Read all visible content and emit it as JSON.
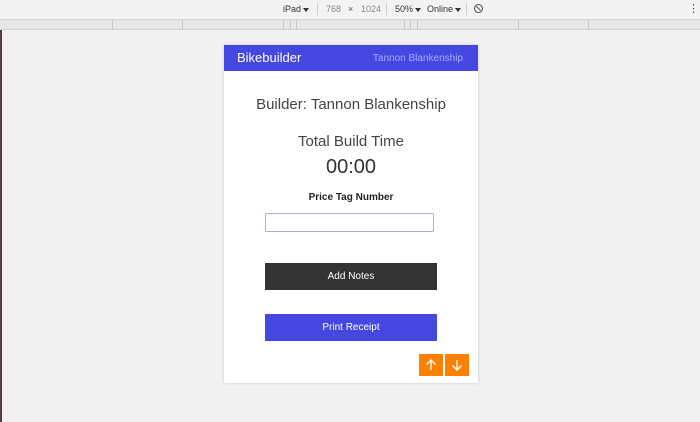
{
  "devtools": {
    "device": "iPad",
    "width": "768",
    "times": "×",
    "height": "1024",
    "zoom": "50%",
    "network": "Online",
    "rotate_icon": "rotate-icon",
    "more_icon": "more-vertical-icon"
  },
  "app": {
    "brand": "Bikebuilder",
    "header_user": "Tannon Blankenship",
    "colors": {
      "primary": "#4448e0",
      "dark": "#333333",
      "orange": "#ff7f00"
    }
  },
  "content": {
    "builder_line": "Builder: Tannon Blankenship",
    "total_label": "Total Build Time",
    "timer": "00:00",
    "price_label": "Price Tag Number",
    "price_value": "",
    "add_notes_label": "Add Notes",
    "print_label": "Print Receipt",
    "scroll_up_icon": "arrow-up-icon",
    "scroll_down_icon": "arrow-down-icon"
  }
}
